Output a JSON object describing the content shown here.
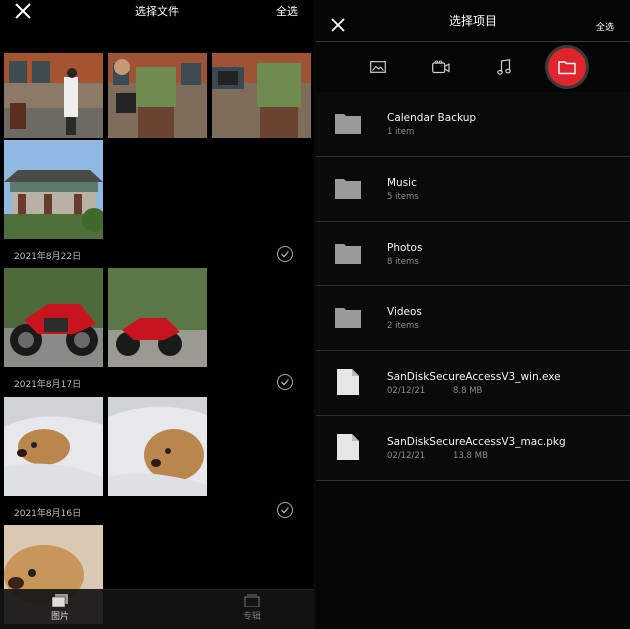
{
  "left": {
    "title": "选择文件",
    "select_all": "全选",
    "groups": [
      {
        "date": ""
      },
      {
        "date": "2021年8月22日"
      },
      {
        "date": "2021年8月17日"
      },
      {
        "date": "2021年8月16日"
      }
    ],
    "tabs": [
      {
        "label": "图片",
        "icon": "photos-icon"
      },
      {
        "label": "专辑",
        "icon": "albums-icon"
      }
    ]
  },
  "right": {
    "title": "选择项目",
    "select_all": "全选",
    "type_filters": [
      "image-icon",
      "video-icon",
      "music-icon",
      "folder-icon"
    ],
    "active_filter": "folder-icon",
    "items": [
      {
        "kind": "folder",
        "name": "Calendar Backup",
        "meta": "1 item"
      },
      {
        "kind": "folder",
        "name": "Music",
        "meta": "5 items"
      },
      {
        "kind": "folder",
        "name": "Photos",
        "meta": "8 items"
      },
      {
        "kind": "folder",
        "name": "Videos",
        "meta": "2 items"
      },
      {
        "kind": "file",
        "name": "SanDiskSecureAccessV3_win.exe",
        "date": "02/12/21",
        "size": "8.8 MB"
      },
      {
        "kind": "file",
        "name": "SanDiskSecureAccessV3_mac.pkg",
        "date": "02/12/21",
        "size": "13.8 MB"
      }
    ]
  },
  "colors": {
    "accent": "#e0242c",
    "background": "#000000",
    "divider": "#2e2e2e"
  }
}
